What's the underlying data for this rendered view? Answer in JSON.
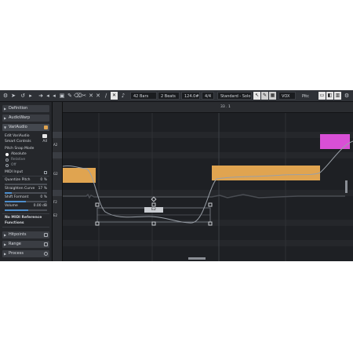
{
  "toolbar": {
    "bars": "42 Bars",
    "beats": "2 Beats",
    "tempo": "124.0#",
    "signature": "4/4",
    "preset": "Standard - Solo",
    "track": "VOX",
    "pitch": "Pitc"
  },
  "inspector": {
    "sections": {
      "definition": "Definition",
      "audiowarp": "AudioWarp",
      "variaudio": "VariAudio",
      "hitpoints": "Hitpoints",
      "range": "Range",
      "process": "Process"
    },
    "edit_variaudio": "Edit VariAudio",
    "smart_controls": "Smart Controls",
    "smart_controls_value": "All",
    "pitch_snap_mode": "Pitch Snap Mode",
    "snap_options": [
      "Absolute",
      "Relative",
      "Off"
    ],
    "snap_selected": "Absolute",
    "midi_input": "MIDI Input",
    "quantize_pitch": "Quantize Pitch",
    "quantize_pitch_value": "0 %",
    "quantize_pitch_level": 0.0,
    "straighten_curve": "Straighten Curve",
    "straighten_curve_value": "17 %",
    "straighten_curve_level": 0.17,
    "shift_formant": "Shift Formant",
    "shift_formant_value": "0 %",
    "shift_formant_level": 0.5,
    "volume": "Volume",
    "volume_value": "0.00 dB",
    "volume_level": 0.55,
    "no_midi_reference": "No MIDI Reference",
    "functions": "Functions"
  },
  "keys": {
    "a2": "A2",
    "g2": "G2",
    "f2": "F2",
    "e2": "E2"
  },
  "ruler": {
    "position": "33 . 1"
  },
  "notes": {
    "selected_label": "E2"
  },
  "colors": {
    "note_orange": "#e0a450",
    "note_magenta": "#d94fd6",
    "accent_blue": "#4d8ecc"
  }
}
